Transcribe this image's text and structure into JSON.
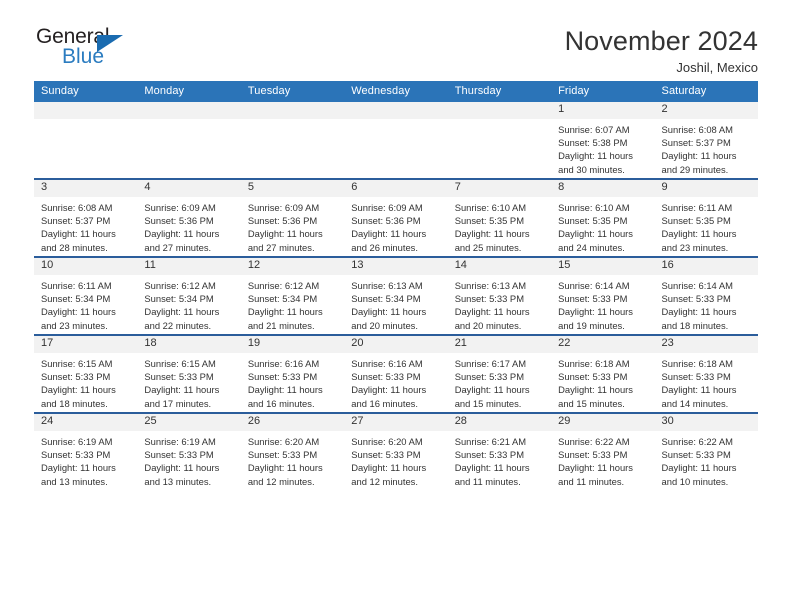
{
  "brand": {
    "name_part1": "General",
    "name_part2": "Blue",
    "logo_icon": "blue-triangle-icon",
    "accent_color": "#2b7cc0"
  },
  "header": {
    "title": "November 2024",
    "location": "Joshil, Mexico"
  },
  "theme": {
    "header_bg": "#2b74b8",
    "week_divider": "#2b5d9b",
    "daynum_band": "#f2f2f2",
    "text": "#333333"
  },
  "calendar": {
    "weekday_headers": [
      "Sunday",
      "Monday",
      "Tuesday",
      "Wednesday",
      "Thursday",
      "Friday",
      "Saturday"
    ],
    "labels": {
      "sunrise": "Sunrise:",
      "sunset": "Sunset:",
      "daylight": "Daylight:"
    },
    "weeks": [
      [
        {
          "day": "",
          "empty": true
        },
        {
          "day": "",
          "empty": true
        },
        {
          "day": "",
          "empty": true
        },
        {
          "day": "",
          "empty": true
        },
        {
          "day": "",
          "empty": true
        },
        {
          "day": "1",
          "sunrise": "Sunrise: 6:07 AM",
          "sunset": "Sunset: 5:38 PM",
          "daylight": "Daylight: 11 hours and 30 minutes."
        },
        {
          "day": "2",
          "sunrise": "Sunrise: 6:08 AM",
          "sunset": "Sunset: 5:37 PM",
          "daylight": "Daylight: 11 hours and 29 minutes."
        }
      ],
      [
        {
          "day": "3",
          "sunrise": "Sunrise: 6:08 AM",
          "sunset": "Sunset: 5:37 PM",
          "daylight": "Daylight: 11 hours and 28 minutes."
        },
        {
          "day": "4",
          "sunrise": "Sunrise: 6:09 AM",
          "sunset": "Sunset: 5:36 PM",
          "daylight": "Daylight: 11 hours and 27 minutes."
        },
        {
          "day": "5",
          "sunrise": "Sunrise: 6:09 AM",
          "sunset": "Sunset: 5:36 PM",
          "daylight": "Daylight: 11 hours and 27 minutes."
        },
        {
          "day": "6",
          "sunrise": "Sunrise: 6:09 AM",
          "sunset": "Sunset: 5:36 PM",
          "daylight": "Daylight: 11 hours and 26 minutes."
        },
        {
          "day": "7",
          "sunrise": "Sunrise: 6:10 AM",
          "sunset": "Sunset: 5:35 PM",
          "daylight": "Daylight: 11 hours and 25 minutes."
        },
        {
          "day": "8",
          "sunrise": "Sunrise: 6:10 AM",
          "sunset": "Sunset: 5:35 PM",
          "daylight": "Daylight: 11 hours and 24 minutes."
        },
        {
          "day": "9",
          "sunrise": "Sunrise: 6:11 AM",
          "sunset": "Sunset: 5:35 PM",
          "daylight": "Daylight: 11 hours and 23 minutes."
        }
      ],
      [
        {
          "day": "10",
          "sunrise": "Sunrise: 6:11 AM",
          "sunset": "Sunset: 5:34 PM",
          "daylight": "Daylight: 11 hours and 23 minutes."
        },
        {
          "day": "11",
          "sunrise": "Sunrise: 6:12 AM",
          "sunset": "Sunset: 5:34 PM",
          "daylight": "Daylight: 11 hours and 22 minutes."
        },
        {
          "day": "12",
          "sunrise": "Sunrise: 6:12 AM",
          "sunset": "Sunset: 5:34 PM",
          "daylight": "Daylight: 11 hours and 21 minutes."
        },
        {
          "day": "13",
          "sunrise": "Sunrise: 6:13 AM",
          "sunset": "Sunset: 5:34 PM",
          "daylight": "Daylight: 11 hours and 20 minutes."
        },
        {
          "day": "14",
          "sunrise": "Sunrise: 6:13 AM",
          "sunset": "Sunset: 5:33 PM",
          "daylight": "Daylight: 11 hours and 20 minutes."
        },
        {
          "day": "15",
          "sunrise": "Sunrise: 6:14 AM",
          "sunset": "Sunset: 5:33 PM",
          "daylight": "Daylight: 11 hours and 19 minutes."
        },
        {
          "day": "16",
          "sunrise": "Sunrise: 6:14 AM",
          "sunset": "Sunset: 5:33 PM",
          "daylight": "Daylight: 11 hours and 18 minutes."
        }
      ],
      [
        {
          "day": "17",
          "sunrise": "Sunrise: 6:15 AM",
          "sunset": "Sunset: 5:33 PM",
          "daylight": "Daylight: 11 hours and 18 minutes."
        },
        {
          "day": "18",
          "sunrise": "Sunrise: 6:15 AM",
          "sunset": "Sunset: 5:33 PM",
          "daylight": "Daylight: 11 hours and 17 minutes."
        },
        {
          "day": "19",
          "sunrise": "Sunrise: 6:16 AM",
          "sunset": "Sunset: 5:33 PM",
          "daylight": "Daylight: 11 hours and 16 minutes."
        },
        {
          "day": "20",
          "sunrise": "Sunrise: 6:16 AM",
          "sunset": "Sunset: 5:33 PM",
          "daylight": "Daylight: 11 hours and 16 minutes."
        },
        {
          "day": "21",
          "sunrise": "Sunrise: 6:17 AM",
          "sunset": "Sunset: 5:33 PM",
          "daylight": "Daylight: 11 hours and 15 minutes."
        },
        {
          "day": "22",
          "sunrise": "Sunrise: 6:18 AM",
          "sunset": "Sunset: 5:33 PM",
          "daylight": "Daylight: 11 hours and 15 minutes."
        },
        {
          "day": "23",
          "sunrise": "Sunrise: 6:18 AM",
          "sunset": "Sunset: 5:33 PM",
          "daylight": "Daylight: 11 hours and 14 minutes."
        }
      ],
      [
        {
          "day": "24",
          "sunrise": "Sunrise: 6:19 AM",
          "sunset": "Sunset: 5:33 PM",
          "daylight": "Daylight: 11 hours and 13 minutes."
        },
        {
          "day": "25",
          "sunrise": "Sunrise: 6:19 AM",
          "sunset": "Sunset: 5:33 PM",
          "daylight": "Daylight: 11 hours and 13 minutes."
        },
        {
          "day": "26",
          "sunrise": "Sunrise: 6:20 AM",
          "sunset": "Sunset: 5:33 PM",
          "daylight": "Daylight: 11 hours and 12 minutes."
        },
        {
          "day": "27",
          "sunrise": "Sunrise: 6:20 AM",
          "sunset": "Sunset: 5:33 PM",
          "daylight": "Daylight: 11 hours and 12 minutes."
        },
        {
          "day": "28",
          "sunrise": "Sunrise: 6:21 AM",
          "sunset": "Sunset: 5:33 PM",
          "daylight": "Daylight: 11 hours and 11 minutes."
        },
        {
          "day": "29",
          "sunrise": "Sunrise: 6:22 AM",
          "sunset": "Sunset: 5:33 PM",
          "daylight": "Daylight: 11 hours and 11 minutes."
        },
        {
          "day": "30",
          "sunrise": "Sunrise: 6:22 AM",
          "sunset": "Sunset: 5:33 PM",
          "daylight": "Daylight: 11 hours and 10 minutes."
        }
      ]
    ]
  }
}
